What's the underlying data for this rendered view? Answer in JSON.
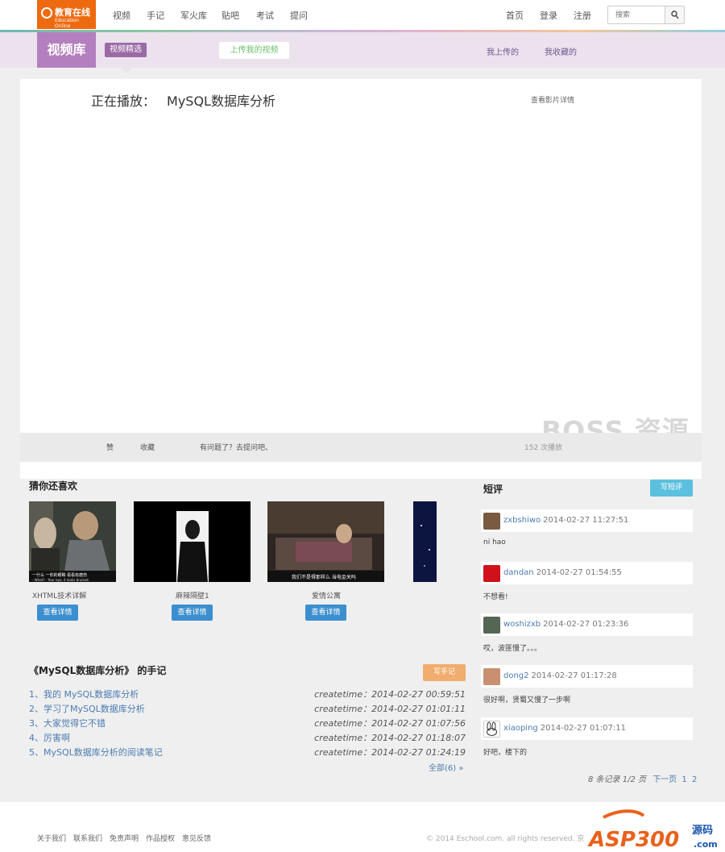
{
  "header": {
    "logo_text": "教育在线",
    "logo_sub": "Education Online",
    "nav": [
      "视频",
      "手记",
      "军火库",
      "贴吧",
      "考试",
      "提问"
    ],
    "right_links": [
      "首页",
      "登录",
      "注册"
    ],
    "search_placeholder": "搜索",
    "search_btn_glyph": "fl"
  },
  "subheader": {
    "title": "视频库",
    "selected_tag": "视频精选",
    "upload_label": "上传我的视频",
    "my_uploads": "我上传的",
    "my_favorites": "我收藏的"
  },
  "player": {
    "now_playing_label": "正在播放：",
    "video_title": "MySQL数据库分析",
    "detail_link": "查看影片详情",
    "like": "赞",
    "favorite": "收藏",
    "ask": "有问题了？去提问吧、",
    "play_count": "152 次播放"
  },
  "watermark": "BOSS 资源",
  "recommend": {
    "title": "猜你还喜欢",
    "items": [
      {
        "caption": "XHTML技术详解",
        "button": "查看详情"
      },
      {
        "caption": "麻辣隔壁1",
        "button": "查看详情"
      },
      {
        "caption": "爱情公寓",
        "button": "查看详情"
      }
    ],
    "subtitle_1": "一什么 一你的眼睛 看看有磨伤",
    "subtitle_1b": "- What? - Your eye, it looks bruised.",
    "subtitle_3": "我们不是得那样么 当电金关吗"
  },
  "notes": {
    "title": "《MySQL数据库分析》 的手记",
    "write_btn": "写手记",
    "items": [
      {
        "title": "1、我的 MySQL数据库分析",
        "time": "createtime：2014-02-27 00:59:51"
      },
      {
        "title": "2、学习了MySQL数据库分析",
        "time": "createtime：2014-02-27 01:01:11"
      },
      {
        "title": "3、大家觉得它不错",
        "time": "createtime：2014-02-27 01:07:56"
      },
      {
        "title": "4、厉害啊",
        "time": "createtime：2014-02-27 01:18:07"
      },
      {
        "title": "5、MySQL数据库分析的阅读笔记",
        "time": "createtime：2014-02-27 01:24:19"
      }
    ],
    "all_link": "全部(6) »"
  },
  "reviews": {
    "title": "短评",
    "write_btn": "写短评",
    "items": [
      {
        "user": "zxbshiwo",
        "time": "2014-02-27 11:27:51",
        "text": "ni hao",
        "avatar_color": "#7a5a40"
      },
      {
        "user": "dandan",
        "time": "2014-02-27 01:54:55",
        "text": "不想看!",
        "avatar_color": "#d0101a"
      },
      {
        "user": "woshizxb",
        "time": "2014-02-27 01:23:36",
        "text": "哎，波匪慢了。。。",
        "avatar_color": "#556655"
      },
      {
        "user": "dong2",
        "time": "2014-02-27 01:17:28",
        "text": "很好啊，贤蜀又慢了一步啊",
        "avatar_color": "#c89070"
      },
      {
        "user": "xiaoping",
        "time": "2014-02-27 01:07:11",
        "text": "好吧，楼下的",
        "avatar_color": "#ffffff"
      }
    ],
    "pager_text": "8 条记录 1/2 页",
    "pager_next": "下一页",
    "pager_pages": [
      "1",
      "2"
    ]
  },
  "footer": {
    "links": [
      "关于我们",
      "联系我们",
      "免责声明",
      "作品授权",
      "意见反馈"
    ],
    "copyright": "© 2014 Eschool.com. all rights reserved. 京",
    "asp_logo": "ASP300",
    "asp_logo_cn": "源码",
    "asp_logo_com": ".com"
  },
  "colors": {
    "logo_orange": "#ee6a10",
    "lib_purple": "#b47fbe",
    "primary_blue": "#3b8fcf",
    "note_btn_orange": "#f0ad6e",
    "review_btn_cyan": "#5bc0de"
  }
}
